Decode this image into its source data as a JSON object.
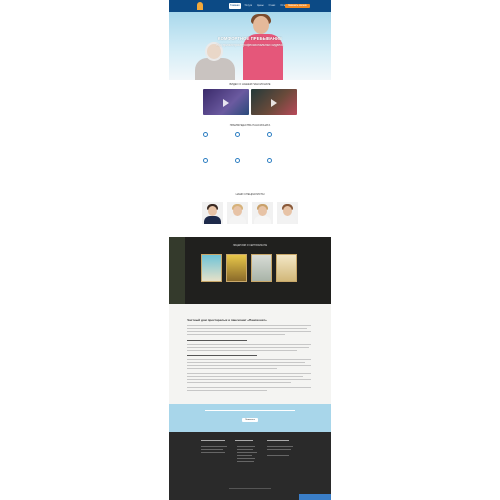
{
  "header": {
    "nav": [
      "Главная",
      "Услуги",
      "Цены",
      "О нас",
      "Отзывы",
      "Контакты"
    ],
    "cta_label": "Заказать звонок"
  },
  "hero": {
    "title": "КОМФОРТНОЕ ПРЕБЫВАНИЕ",
    "subtitle": "под присмотром профессиональных сиделок"
  },
  "videos": {
    "section_title": "Видео о нашем пансионате"
  },
  "features": {
    "section_title": "Преимущества пансионата"
  },
  "team": {
    "section_title": "Наши специалисты"
  },
  "certificates": {
    "section_title": "Лицензии и сертификаты"
  },
  "article": {
    "title": "Частный дом престарелых и пансионат «Пансионат»"
  },
  "callout": {
    "button_label": "Позвонить"
  },
  "colors": {
    "header": "#0c4a85",
    "accent": "#f08a24",
    "hero_sky": "#a9d8ec",
    "callout": "#a8d6ea",
    "footer": "#2a2a2a"
  }
}
